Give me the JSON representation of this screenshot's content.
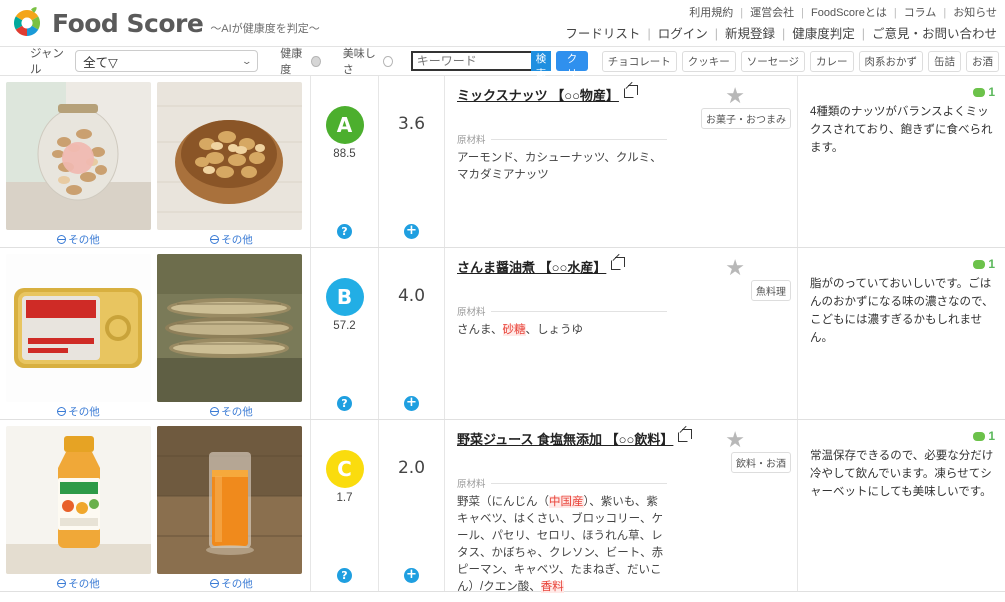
{
  "header": {
    "brand_name": "Food Score",
    "brand_tagline": "～AIが健康度を判定～",
    "logo_icon": "foodscore-logo-icon",
    "nav_top": [
      "利用規約",
      "運営会社",
      "FoodScoreとは",
      "コラム",
      "お知らせ"
    ],
    "nav_bottom": [
      "フードリスト",
      "ログイン",
      "新規登録",
      "健康度判定",
      "ご意見・お問い合わせ"
    ],
    "nav_separator": "|"
  },
  "filter": {
    "genre_label": "ジャンル",
    "genre_value": "全て▽",
    "chevron_icon": "chevron-down-icon",
    "health_toggle_label": "健康度",
    "health_toggle_state": "on",
    "taste_toggle_label": "美味しさ",
    "taste_toggle_state": "off",
    "keyword_placeholder": "キーワード",
    "keyword_value": "",
    "search_button": "検索",
    "clear_button": "クリア",
    "tags": [
      "チョコレート",
      "クッキー",
      "ソーセージ",
      "カレー",
      "肉系おかず",
      "缶詰",
      "お酒"
    ]
  },
  "labels": {
    "ingredients_heading": "原材料",
    "source_link": "その他",
    "globe_icon": "globe-icon",
    "help_icon": "help-circle-icon",
    "plus_icon": "plus-circle-icon",
    "star_icon": "star-icon",
    "external_link_icon": "external-link-icon",
    "comment_icon": "comment-bubble-icon",
    "help_glyph": "?",
    "plus_glyph": "+",
    "star_glyph": "★"
  },
  "colors": {
    "grade_a": "#4CAF2E",
    "grade_b": "#22AEE5",
    "grade_c": "#FADC0E",
    "accent_blue": "#1f8fe0",
    "comment_green": "#5cb85c",
    "highlight_red": "#e8443a"
  },
  "items": [
    {
      "title": "ミックスナッツ 【○○物産】",
      "grade": "A",
      "grade_color": "#4CAF2E",
      "score": "88.5",
      "taste": "3.6",
      "category": "お菓子・おつまみ",
      "ingredients_plain": "アーモンド、カシューナッツ、クルミ、マカダミアナッツ",
      "ingredients_parts": [
        {
          "t": "アーモンド、カシューナッツ、クルミ、マカダミアナッツ",
          "hl": false
        }
      ],
      "comment_count": "1",
      "comment": "4種類のナッツがバランスよくミックスされており、飽きずに食べられます。",
      "image_left_label": "その他",
      "image_right_label": "その他"
    },
    {
      "title": "さんま醤油煮 【○○水産】",
      "grade": "B",
      "grade_color": "#22AEE5",
      "score": "57.2",
      "taste": "4.0",
      "category": "魚料理",
      "ingredients_plain": "さんま、砂糖、しょうゆ",
      "ingredients_parts": [
        {
          "t": "さんま、",
          "hl": false
        },
        {
          "t": "砂糖",
          "hl": true
        },
        {
          "t": "、しょうゆ",
          "hl": false
        }
      ],
      "comment_count": "1",
      "comment": "脂がのっていておいしいです。ごはんのおかずになる味の濃さなので、こどもには濃すぎるかもしれません。",
      "image_left_label": "その他",
      "image_right_label": "その他"
    },
    {
      "title": "野菜ジュース 食塩無添加 【○○飲料】",
      "grade": "C",
      "grade_color": "#FADC0E",
      "score": "1.7",
      "taste": "2.0",
      "category": "飲料・お酒",
      "ingredients_plain": "野菜（にんじん（中国産）、紫いも、紫キャベツ、はくさい、ブロッコリー、ケール、パセリ、セロリ、ほうれん草、レタス、かぼちゃ、クレソン、ビート、赤ピーマン、キャベツ、たまねぎ、だいこん）/クエン酸、香料",
      "ingredients_parts": [
        {
          "t": "野菜（にんじん（",
          "hl": false
        },
        {
          "t": "中国産",
          "hl": true
        },
        {
          "t": "）、紫いも、紫キャベツ、はくさい、ブロッコリー、ケール、パセリ、セロリ、ほうれん草、レタス、かぼちゃ、クレソン、ビート、赤ピーマン、キャベツ、たまねぎ、だいこん）/クエン酸、",
          "hl": false
        },
        {
          "t": "香料",
          "hl": true
        }
      ],
      "comment_count": "1",
      "comment": "常温保存できるので、必要な分だけ冷やして飲んでいます。凍らせてシャーベットにしても美味しいです。",
      "image_left_label": "その他",
      "image_right_label": "その他"
    }
  ]
}
